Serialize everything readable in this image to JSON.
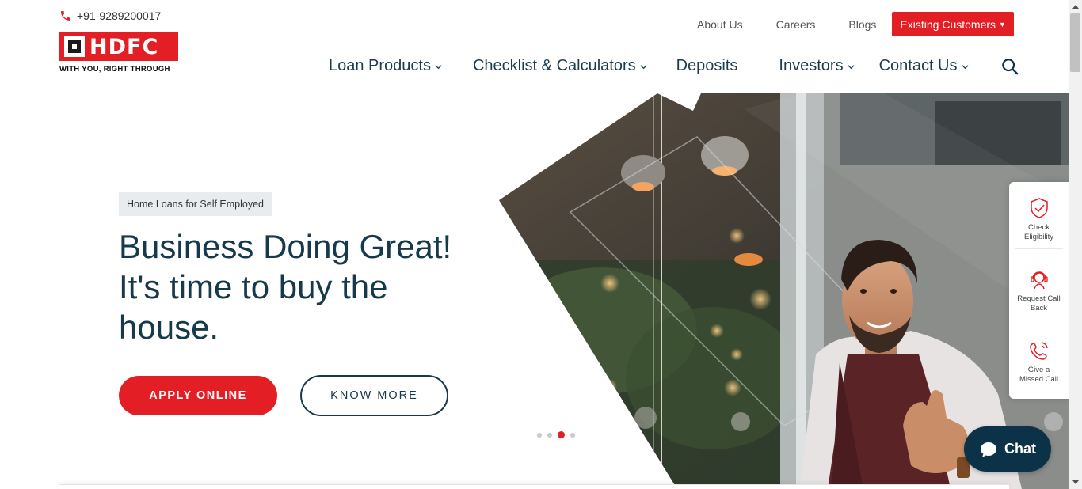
{
  "header": {
    "phone": "+91-9289200017",
    "logo": {
      "word": "HDFC",
      "tagline": "WITH YOU, RIGHT THROUGH"
    },
    "top_links": {
      "about": "About Us",
      "careers": "Careers",
      "blogs": "Blogs",
      "existing": "Existing Customers"
    },
    "nav": {
      "loan_products": "Loan Products",
      "checklist": "Checklist & Calculators",
      "deposits": "Deposits",
      "investors": "Investors",
      "contact": "Contact Us"
    }
  },
  "hero": {
    "badge": "Home Loans for Self Employed",
    "headline_1": "Business Doing Great!",
    "headline_2": "It's time to buy the",
    "headline_3": "house.",
    "apply_label": "APPLY ONLINE",
    "know_label": "KNOW MORE",
    "slides": 4,
    "active_slide": 3
  },
  "side_widget": {
    "check": "Check Eligibility",
    "request": "Request Call Back",
    "missed": "Give a Missed Call"
  },
  "chat": {
    "label": "Chat"
  },
  "colors": {
    "brand_red": "#e31e24",
    "navy": "#16394b",
    "chat_bg": "#0b3247"
  }
}
